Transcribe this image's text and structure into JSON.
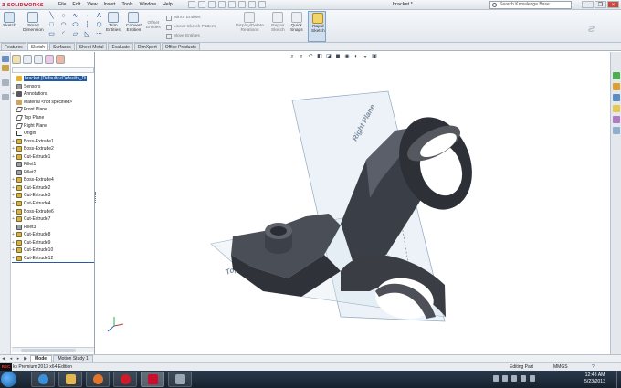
{
  "app": {
    "name": "SOLIDWORKS",
    "doc_title": "bracket *"
  },
  "menu": [
    "File",
    "Edit",
    "View",
    "Insert",
    "Tools",
    "Window",
    "Help"
  ],
  "search": {
    "placeholder": "Search Knowledge Base"
  },
  "command_manager": {
    "sketch": "Sketch",
    "smart_dimension": [
      "Smart",
      "Dimension"
    ],
    "trim_entities": [
      "Trim",
      "Entities"
    ],
    "convert_entities": [
      "Convert",
      "Entities"
    ],
    "offset_entities": [
      "Offset",
      "Entities"
    ],
    "mirror_entities": "Mirror Entities",
    "linear_sketch_pattern": "Linear Sketch Pattern",
    "move_entities": "Move Entities",
    "display_delete_relations": [
      "Display/Delete",
      "Relations"
    ],
    "repair_sketch": [
      "Repair",
      "Sketch"
    ],
    "quick_snaps": [
      "Quick",
      "Snaps"
    ],
    "rapid_sketch": [
      "Rapid",
      "Sketch"
    ]
  },
  "tabs": [
    "Features",
    "Sketch",
    "Surfaces",
    "Sheet Metal",
    "Evaluate",
    "DimXpert",
    "Office Products"
  ],
  "active_tab": "Sketch",
  "tree": [
    {
      "label": "bracket  (Default<<Default>_Di",
      "icon": "part-icon",
      "selected": true,
      "exp": ""
    },
    {
      "label": "Sensors",
      "icon": "sensor-icon",
      "exp": ""
    },
    {
      "label": "Annotations",
      "icon": "annotation-icon",
      "exp": "+"
    },
    {
      "label": "Material <not specified>",
      "icon": "material-icon",
      "exp": ""
    },
    {
      "label": "Front Plane",
      "icon": "plane-icon",
      "exp": ""
    },
    {
      "label": "Top Plane",
      "icon": "plane-icon",
      "exp": ""
    },
    {
      "label": "Right Plane",
      "icon": "plane-icon",
      "exp": ""
    },
    {
      "label": "Origin",
      "icon": "origin-icon",
      "exp": ""
    },
    {
      "label": "Boss-Extrude1",
      "icon": "feature-icon",
      "exp": "+"
    },
    {
      "label": "Boss-Extrude2",
      "icon": "feature-icon",
      "exp": "+"
    },
    {
      "label": "Cut-Extrude1",
      "icon": "feature-icon",
      "exp": "+"
    },
    {
      "label": "Fillet1",
      "icon": "fillet-icon",
      "exp": ""
    },
    {
      "label": "Fillet2",
      "icon": "fillet-icon",
      "exp": ""
    },
    {
      "label": "Boss-Extrude4",
      "icon": "feature-icon",
      "exp": "+"
    },
    {
      "label": "Cut-Extrude2",
      "icon": "feature-icon",
      "exp": "+"
    },
    {
      "label": "Cut-Extrude3",
      "icon": "feature-icon",
      "exp": "+"
    },
    {
      "label": "Cut-Extrude4",
      "icon": "feature-icon",
      "exp": "+"
    },
    {
      "label": "Boss-Extrude6",
      "icon": "feature-icon",
      "exp": "+"
    },
    {
      "label": "Cut-Extrude7",
      "icon": "feature-icon",
      "exp": "+"
    },
    {
      "label": "Fillet3",
      "icon": "fillet-icon",
      "exp": ""
    },
    {
      "label": "Cut-Extrude8",
      "icon": "feature-icon",
      "exp": "+"
    },
    {
      "label": "Cut-Extrude9",
      "icon": "feature-icon",
      "exp": "+"
    },
    {
      "label": "Cut-Extrude10",
      "icon": "feature-icon",
      "exp": "+"
    },
    {
      "label": "Cut-Extrude12",
      "icon": "feature-icon",
      "exp": "+"
    }
  ],
  "viewport": {
    "right_plane_label": "Right Plane",
    "top_plane_label": "Top"
  },
  "bottom_tabs": [
    "Model",
    "Motion Study 1"
  ],
  "status": {
    "rec": "REC",
    "edition": "ks Premium 2013 x64 Edition",
    "mode": "Editing Part",
    "units": "MMGS",
    "help": "?"
  },
  "clock": {
    "time": "12:43 AM",
    "date": "5/23/2013"
  }
}
